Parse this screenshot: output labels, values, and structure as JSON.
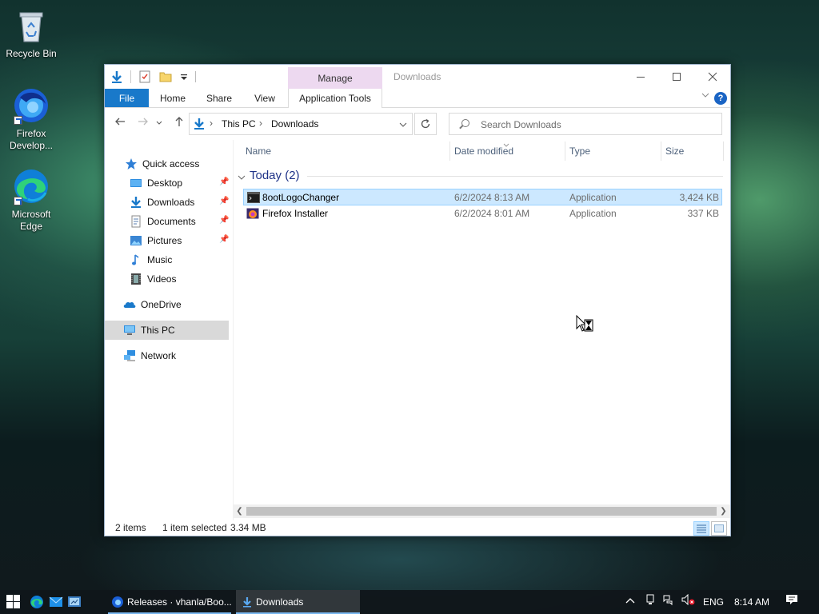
{
  "desktop": {
    "icons": [
      {
        "label": "Recycle Bin"
      },
      {
        "label": "Firefox Develop..."
      },
      {
        "label": "Microsoft Edge"
      }
    ]
  },
  "window": {
    "title": "Downloads",
    "quick_access_toolbar": [
      "download-arrow-icon",
      "properties-icon",
      "new-folder-icon",
      "customize-dropdown-icon"
    ],
    "contextual_tab_header": "Manage",
    "tabs": [
      "File",
      "Home",
      "Share",
      "View",
      "Application Tools"
    ],
    "address": {
      "segments": [
        "This PC",
        "Downloads"
      ]
    },
    "search": {
      "placeholder": "Search Downloads"
    },
    "nav_pane": {
      "items": [
        {
          "label": "Quick access",
          "icon": "star-icon",
          "pinned": false
        },
        {
          "label": "Desktop",
          "icon": "desktop-folder-icon",
          "pinned": true
        },
        {
          "label": "Downloads",
          "icon": "downloads-folder-icon",
          "pinned": true
        },
        {
          "label": "Documents",
          "icon": "documents-folder-icon",
          "pinned": true
        },
        {
          "label": "Pictures",
          "icon": "pictures-folder-icon",
          "pinned": true
        },
        {
          "label": "Music",
          "icon": "music-icon",
          "pinned": false
        },
        {
          "label": "Videos",
          "icon": "videos-icon",
          "pinned": false
        },
        {
          "label": "OneDrive",
          "icon": "cloud-icon",
          "pinned": false
        },
        {
          "label": "This PC",
          "icon": "computer-icon",
          "pinned": false,
          "selected": true
        },
        {
          "label": "Network",
          "icon": "network-icon",
          "pinned": false
        }
      ]
    },
    "columns": [
      "Name",
      "Date modified",
      "Type",
      "Size"
    ],
    "group": {
      "label": "Today (2)"
    },
    "files": [
      {
        "name": "8ootLogoChanger",
        "date": "6/2/2024 8:13 AM",
        "type": "Application",
        "size": "3,424 KB",
        "selected": true
      },
      {
        "name": "Firefox Installer",
        "date": "6/2/2024 8:01 AM",
        "type": "Application",
        "size": "337 KB",
        "selected": false
      }
    ],
    "status": {
      "count": "2 items",
      "selection": "1 item selected",
      "size": "3.34 MB"
    }
  },
  "taskbar": {
    "apps": [
      {
        "label": "Releases · vhanla/Boo...",
        "icon": "firefox-dev-icon"
      },
      {
        "label": "Downloads",
        "icon": "file-explorer-icon",
        "active": true
      }
    ],
    "language": "ENG",
    "time": "8:14 AM"
  },
  "colors": {
    "accent": "#1979ca",
    "selection": "#cce8ff",
    "manage_tab": "#edd9f0",
    "group_header": "#1e3287"
  }
}
